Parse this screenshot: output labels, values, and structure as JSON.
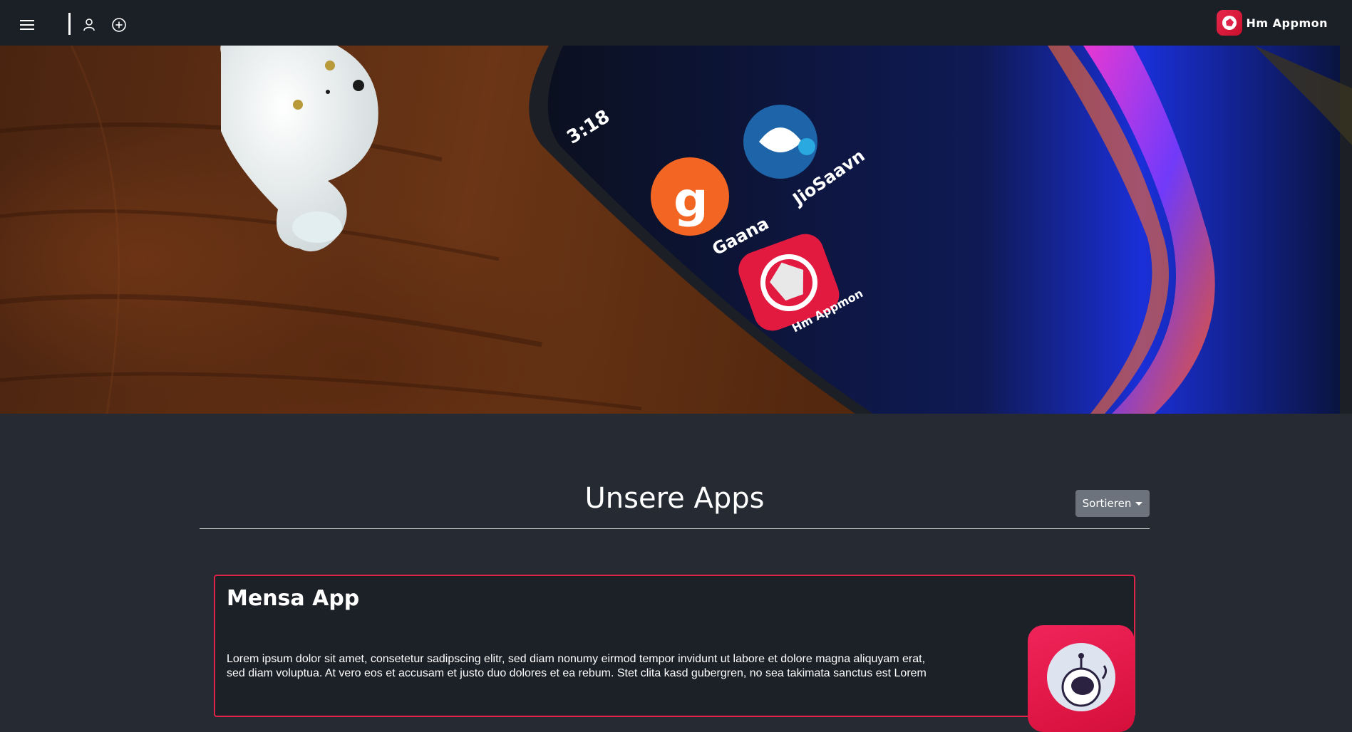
{
  "brand": {
    "name": "Hm Appmon",
    "logo_icon": "appmon-logo-icon",
    "accent": "#e0214a"
  },
  "navbar": {
    "icons": [
      "menu-icon",
      "user-icon",
      "add-circle-icon"
    ]
  },
  "hero": {
    "phone_time": "3:18",
    "apps": [
      {
        "label": "JioSaavn"
      },
      {
        "label": "Gaana",
        "glyph": "g"
      },
      {
        "label": "Hm Appmon"
      }
    ]
  },
  "main": {
    "title": "Unsere Apps",
    "sort_label": "Sortieren",
    "cards": [
      {
        "title": "Mensa App",
        "text": "Lorem ipsum dolor sit amet, consetetur sadipscing elitr, sed diam nonumy eirmod tempor invidunt ut labore et dolore magna aliquyam erat, sed diam voluptua. At vero eos et accusam et justo duo dolores et ea rebum. Stet clita kasd gubergren, no sea takimata sanctus est Lorem"
      }
    ]
  }
}
